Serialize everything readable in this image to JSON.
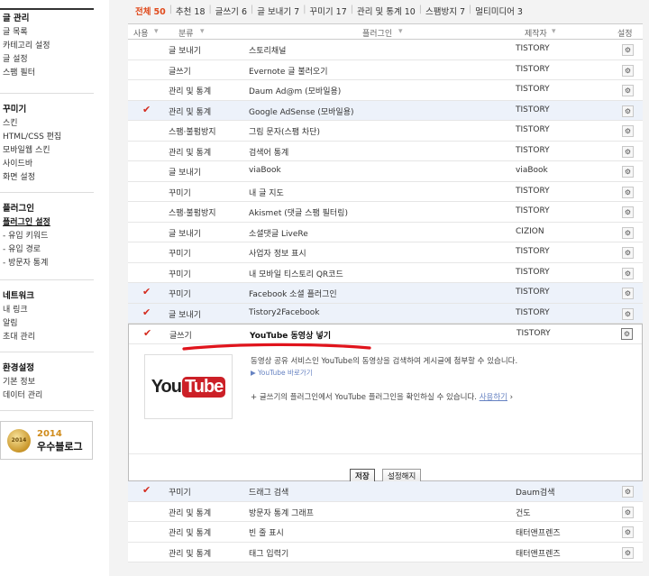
{
  "sidebar": {
    "sections": [
      {
        "title": "글 관리",
        "items": [
          "글 목록",
          "카테고리 설정",
          "글 설정",
          "스팸 필터"
        ]
      },
      {
        "title": "꾸미기",
        "items": [
          "스킨",
          "HTML/CSS 편집",
          "모바일웹 스킨",
          "사이드바",
          "화면 설정"
        ]
      },
      {
        "title": "플러그인",
        "items": [
          "플러그인 설정",
          "- 유입 키워드",
          "- 유입 경로",
          "- 방문자 통계"
        ]
      },
      {
        "title": "네트워크",
        "items": [
          "내 링크",
          "알림",
          "초대 관리"
        ]
      },
      {
        "title": "환경설정",
        "items": [
          "기본 정보",
          "데이터 관리"
        ]
      }
    ],
    "badge": {
      "medal_text": "2014",
      "year": "2014",
      "name": "우수블로그"
    }
  },
  "filters": [
    {
      "label": "전체",
      "count": "50",
      "active": true
    },
    {
      "label": "추천",
      "count": "18"
    },
    {
      "label": "글쓰기",
      "count": "6"
    },
    {
      "label": "글 보내기",
      "count": "7"
    },
    {
      "label": "꾸미기",
      "count": "17"
    },
    {
      "label": "관리 및 통계",
      "count": "10"
    },
    {
      "label": "스팸방지",
      "count": "7"
    },
    {
      "label": "멀티미디어",
      "count": "3"
    }
  ],
  "table": {
    "headers": {
      "use": "사용",
      "category": "분류",
      "plugin": "플러그인",
      "author": "제작자",
      "settings": "설정"
    },
    "rows": [
      {
        "checked": false,
        "category": "글 보내기",
        "name": "스토리채널",
        "author": "TISTORY"
      },
      {
        "checked": false,
        "category": "글쓰기",
        "name": "Evernote 글 불러오기",
        "author": "TISTORY"
      },
      {
        "checked": false,
        "category": "관리 및 통계",
        "name": "Daum Ad@m (모바일용)",
        "author": "TISTORY"
      },
      {
        "checked": true,
        "category": "관리 및 통계",
        "name": "Google AdSense (모바일용)",
        "author": "TISTORY"
      },
      {
        "checked": false,
        "category": "스팸·불펌방지",
        "name": "그림 문자(스팸 차단)",
        "author": "TISTORY"
      },
      {
        "checked": false,
        "category": "관리 및 통계",
        "name": "검색어 통계",
        "author": "TISTORY"
      },
      {
        "checked": false,
        "category": "글 보내기",
        "name": "viaBook",
        "author": "viaBook"
      },
      {
        "checked": false,
        "category": "꾸미기",
        "name": "내 글 지도",
        "author": "TISTORY"
      },
      {
        "checked": false,
        "category": "스팸·불펌방지",
        "name": "Akismet (댓글 스팸 필터링)",
        "author": "TISTORY"
      },
      {
        "checked": false,
        "category": "글 보내기",
        "name": "소셜댓글 LiveRe",
        "author": "CIZION"
      },
      {
        "checked": false,
        "category": "꾸미기",
        "name": "사업자 정보 표시",
        "author": "TISTORY"
      },
      {
        "checked": false,
        "category": "꾸미기",
        "name": "내 모바일 티스토리 QR코드",
        "author": "TISTORY"
      },
      {
        "checked": true,
        "category": "꾸미기",
        "name": "Facebook 소셜 플러그인",
        "author": "TISTORY"
      },
      {
        "checked": true,
        "category": "글 보내기",
        "name": "Tistory2Facebook",
        "author": "TISTORY"
      }
    ],
    "expanded": {
      "checked": true,
      "category": "글쓰기",
      "name": "YouTube 동영상 넣기",
      "author": "TISTORY",
      "logo_you": "You",
      "logo_tube": "Tube",
      "description": "동영상 공유 서비스인 YouTube의 동영상을 검색하여 게시글에 첨부할 수 있습니다.",
      "link": "▶ YouTube 바로가기",
      "note": "+ 글쓰기의 플러그인에서 YouTube 플러그인을 확인하실 수 있습니다.",
      "note_link": "사용하기",
      "save_label": "저장",
      "cancel_label": "설정해지"
    },
    "rows_after": [
      {
        "checked": true,
        "category": "꾸미기",
        "name": "드래그 검색",
        "author": "Daum검색"
      },
      {
        "checked": false,
        "category": "관리 및 통계",
        "name": "방문자 통계 그래프",
        "author": "건도"
      },
      {
        "checked": false,
        "category": "관리 및 통계",
        "name": "빈 줄 표시",
        "author": "태터앤프렌즈"
      },
      {
        "checked": false,
        "category": "관리 및 통계",
        "name": "태그 입력기",
        "author": "태터앤프렌즈"
      }
    ]
  },
  "colors": {
    "accent": "#e04a1c",
    "check": "#d42b1e",
    "selected_row": "#edf2fa",
    "annotation": "#e0141c"
  }
}
